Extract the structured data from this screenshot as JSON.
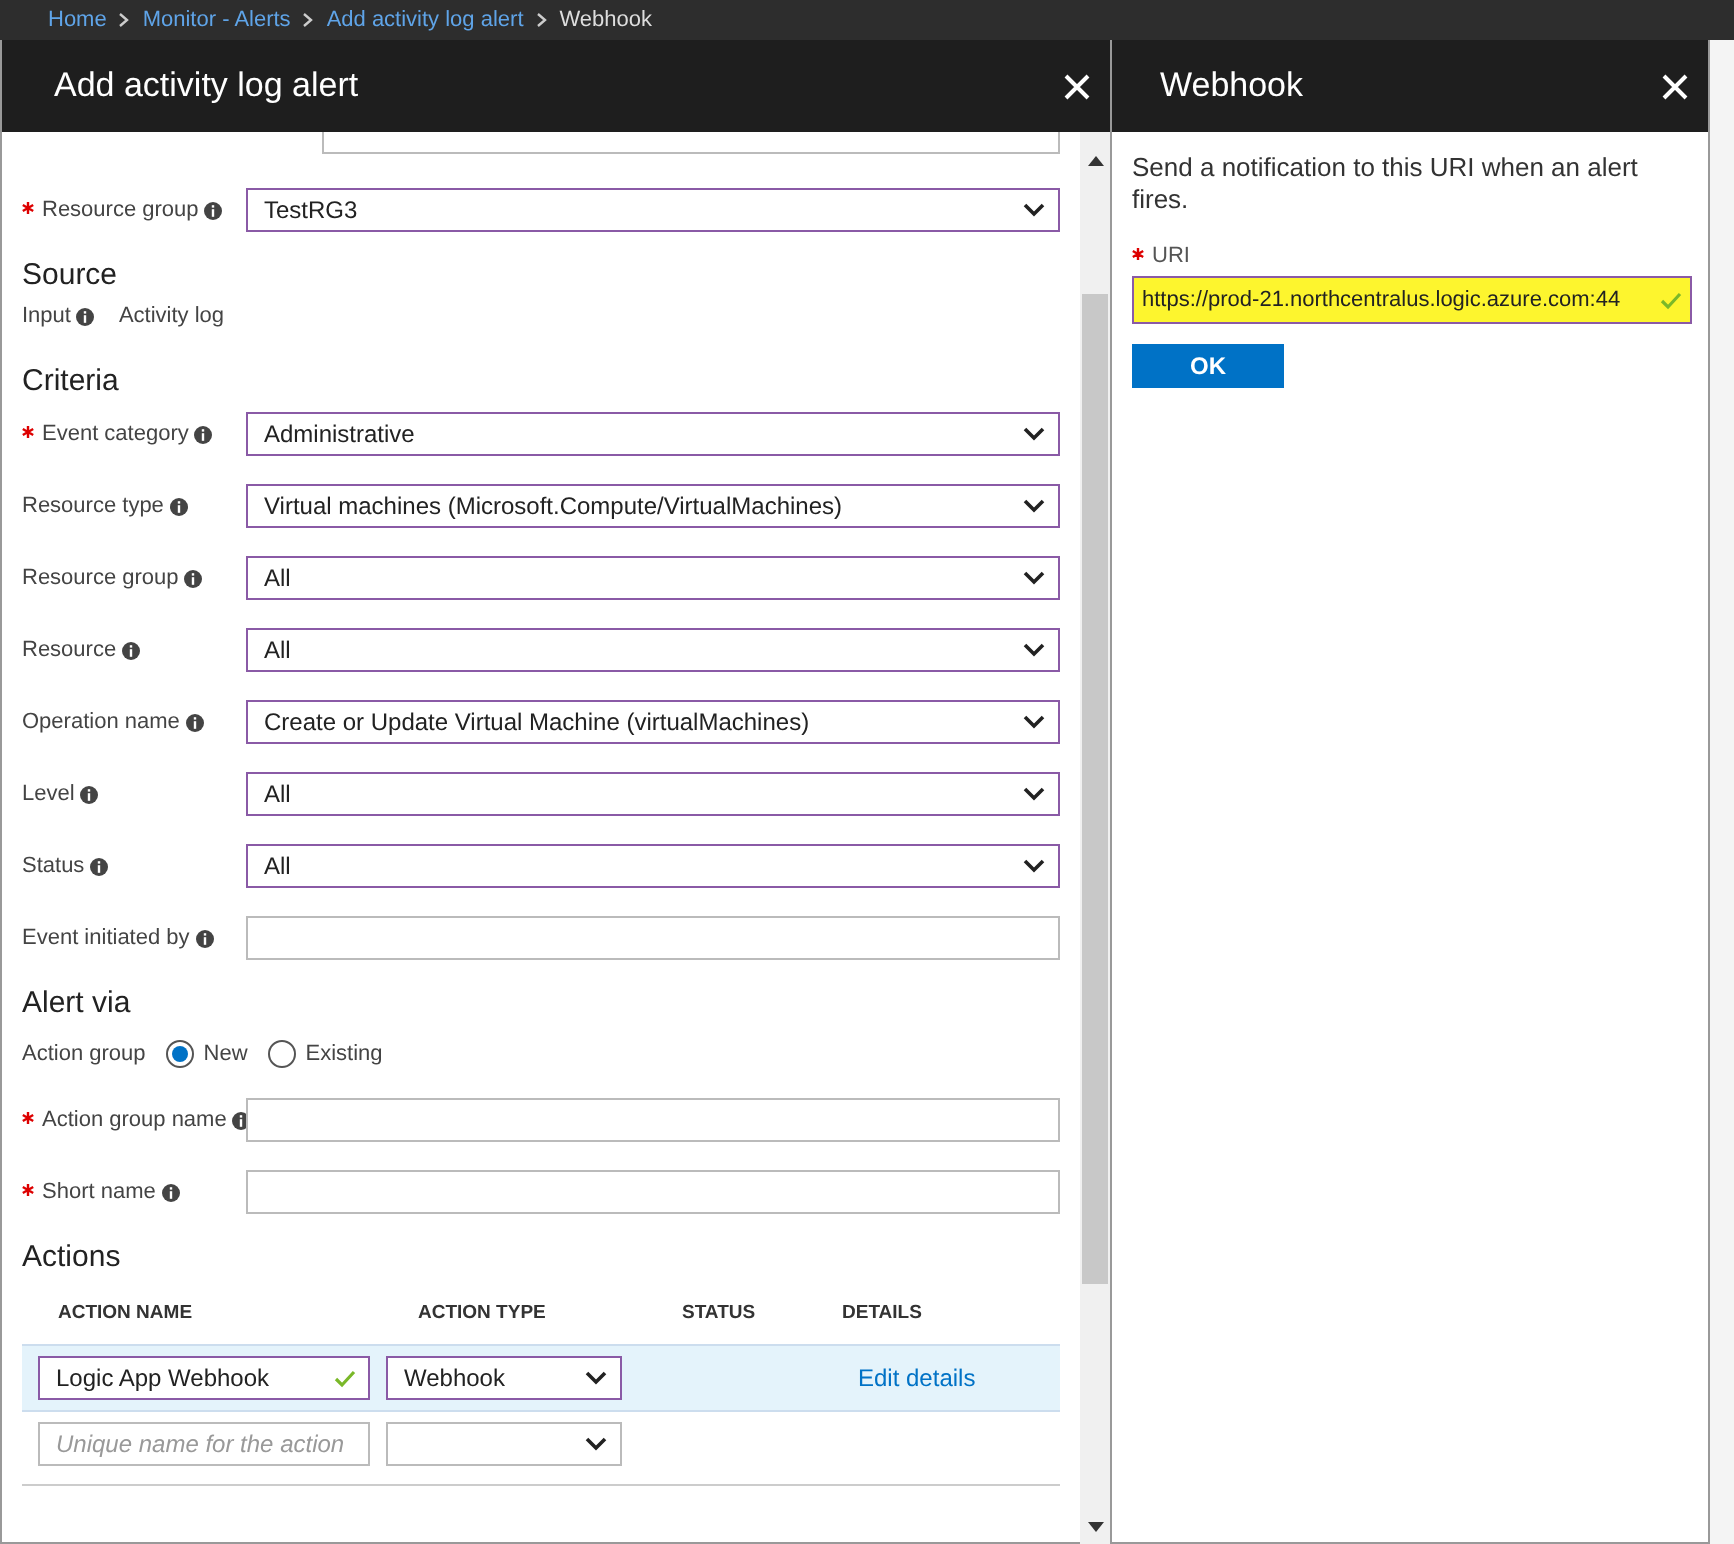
{
  "breadcrumb": [
    {
      "label": "Home",
      "kind": "link"
    },
    {
      "label": "Monitor - Alerts",
      "kind": "link"
    },
    {
      "label": "Add activity log alert",
      "kind": "link"
    },
    {
      "label": "Webhook",
      "kind": "current"
    }
  ],
  "main_blade": {
    "title": "Add activity log alert",
    "items": [
      {
        "kind": "dropdown",
        "label": "Resource group",
        "required": true,
        "info": true,
        "value": "TestRG3"
      },
      {
        "kind": "heading",
        "text": "Source"
      },
      {
        "kind": "static",
        "label": "Input",
        "info": true,
        "value": "Activity log"
      },
      {
        "kind": "heading",
        "text": "Criteria"
      },
      {
        "kind": "dropdown",
        "label": "Event category",
        "required": true,
        "info": true,
        "value": "Administrative"
      },
      {
        "kind": "dropdown",
        "label": "Resource type",
        "required": false,
        "info": true,
        "value": "Virtual machines (Microsoft.Compute/VirtualMachines)"
      },
      {
        "kind": "dropdown",
        "label": "Resource group",
        "required": false,
        "info": true,
        "value": "All"
      },
      {
        "kind": "dropdown",
        "label": "Resource",
        "required": false,
        "info": true,
        "value": "All"
      },
      {
        "kind": "dropdown",
        "label": "Operation name",
        "required": false,
        "info": true,
        "value": "Create or Update Virtual Machine (virtualMachines)"
      },
      {
        "kind": "dropdown",
        "label": "Level",
        "required": false,
        "info": true,
        "value": "All"
      },
      {
        "kind": "dropdown",
        "label": "Status",
        "required": false,
        "info": true,
        "value": "All"
      },
      {
        "kind": "textbox",
        "label": "Event initiated by",
        "required": false,
        "info": true
      },
      {
        "kind": "heading",
        "text": "Alert via"
      },
      {
        "kind": "radio",
        "label": "Action group",
        "options": [
          {
            "label": "New",
            "selected": true
          },
          {
            "label": "Existing",
            "selected": false
          }
        ]
      },
      {
        "kind": "textbox",
        "label": "Action group name",
        "required": true,
        "info": true
      },
      {
        "kind": "textbox",
        "label": "Short name",
        "required": true,
        "info": true
      },
      {
        "kind": "heading",
        "text": "Actions"
      },
      {
        "kind": "table",
        "columns": [
          "ACTION NAME",
          "ACTION TYPE",
          "STATUS",
          "DETAILS"
        ],
        "rows": [
          {
            "name": "Logic App Webhook",
            "valid": true,
            "type": "Webhook",
            "details": "Edit details",
            "selected": true
          },
          {
            "placeholder": "Unique name for the action",
            "valid": false,
            "selected": false
          }
        ]
      }
    ]
  },
  "webhook_blade": {
    "title": "Webhook",
    "description": "Send a notification to this URI when an alert fires.",
    "uri": {
      "label": "URI",
      "required": true,
      "value": "https://prod-21.northcentralus.logic.azure.com:44",
      "valid": true,
      "highlighted": true
    },
    "button": "OK"
  }
}
